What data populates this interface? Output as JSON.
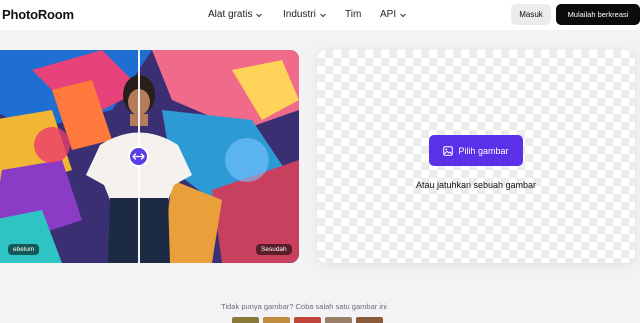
{
  "header": {
    "logo": "PhotoRoom",
    "nav": [
      {
        "label": "Alat gratis",
        "dropdown": true
      },
      {
        "label": "Industri",
        "dropdown": true
      },
      {
        "label": "Tim",
        "dropdown": false
      },
      {
        "label": "API",
        "dropdown": true
      }
    ],
    "login_label": "Masuk",
    "start_label": "Mulailah berkreasi"
  },
  "hero": {
    "before_label": "ebelum",
    "after_label": "Sesudah"
  },
  "upload": {
    "pick_label": "Pilih gambar",
    "drop_text": "Atau jatuhkan sebuah gambar"
  },
  "samples": {
    "prompt": "Tidak punya gambar? Coba salah satu gambar ini",
    "thumb_colors": [
      "#8a7a3a",
      "#c08a3f",
      "#c2453b",
      "#9a7f68",
      "#8a5a3c"
    ]
  },
  "colors": {
    "accent": "#5a31e8",
    "dark": "#0c0c0e"
  }
}
